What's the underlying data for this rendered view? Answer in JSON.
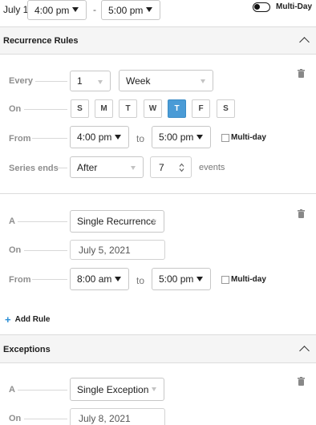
{
  "top": {
    "date": "July 1",
    "start_time": "4:00 pm",
    "dash": "-",
    "end_time": "5:00 pm",
    "multi_day_label": "Multi-Day"
  },
  "recurrence": {
    "section_title": "Recurrence Rules",
    "every_label": "Every",
    "every_value": "1",
    "every_unit": "Week",
    "on_label": "On",
    "days": [
      {
        "label": "S",
        "active": false
      },
      {
        "label": "M",
        "active": false
      },
      {
        "label": "T",
        "active": false
      },
      {
        "label": "W",
        "active": false
      },
      {
        "label": "T",
        "active": true
      },
      {
        "label": "F",
        "active": false
      },
      {
        "label": "S",
        "active": false
      }
    ],
    "from_label": "From",
    "from_time": "4:00 pm",
    "to_label": "to",
    "to_time": "5:00 pm",
    "multi_day_label": "Multi-day",
    "series_ends_label": "Series ends",
    "series_ends_value": "After",
    "count_value": "7",
    "events_label": "events"
  },
  "rule2": {
    "a_label": "A",
    "type_value": "Single Recurrence",
    "on_label": "On",
    "on_date": "July 5, 2021",
    "from_label": "From",
    "from_time": "8:00 am",
    "to_label": "to",
    "to_time": "5:00 pm",
    "multi_day_label": "Multi-day"
  },
  "add_rule_label": "Add Rule",
  "add_rule_icon": "+",
  "exceptions": {
    "section_title": "Exceptions",
    "a_label": "A",
    "type_value": "Single Exception",
    "on_label": "On",
    "on_date": "July 8, 2021"
  },
  "colors": {
    "accent": "#4a9bd6",
    "add_rule_plus": "#2b8fd6"
  }
}
